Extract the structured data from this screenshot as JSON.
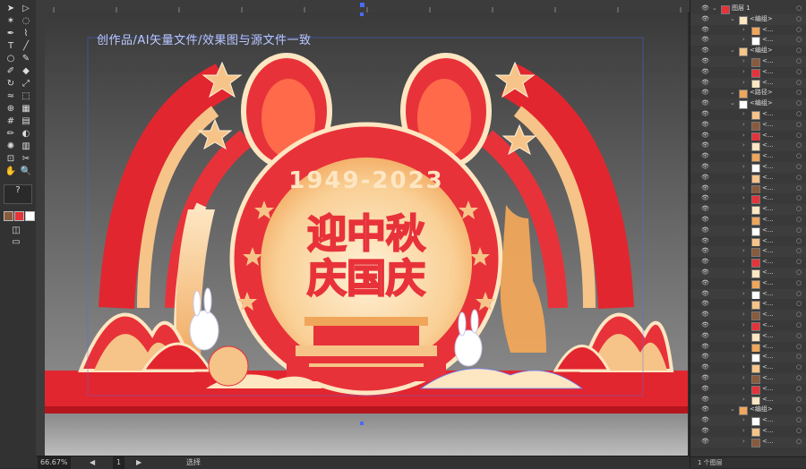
{
  "watermark": "创作品/AI矢量文件/效果图与源文件一致",
  "artwork": {
    "years": "1949-2023",
    "line1": "迎中秋",
    "line2": "庆国庆"
  },
  "status": {
    "zoom": "66.67%",
    "page": "1",
    "mode": "选择",
    "layer_count": "1 个图层"
  },
  "layers": {
    "root": "图层 1",
    "group": "<编组>",
    "path": "<路径>",
    "item": "<..."
  },
  "colors": {
    "accent": "#e8323a",
    "gold": "#f2b46b",
    "cream": "#fde6c2"
  }
}
